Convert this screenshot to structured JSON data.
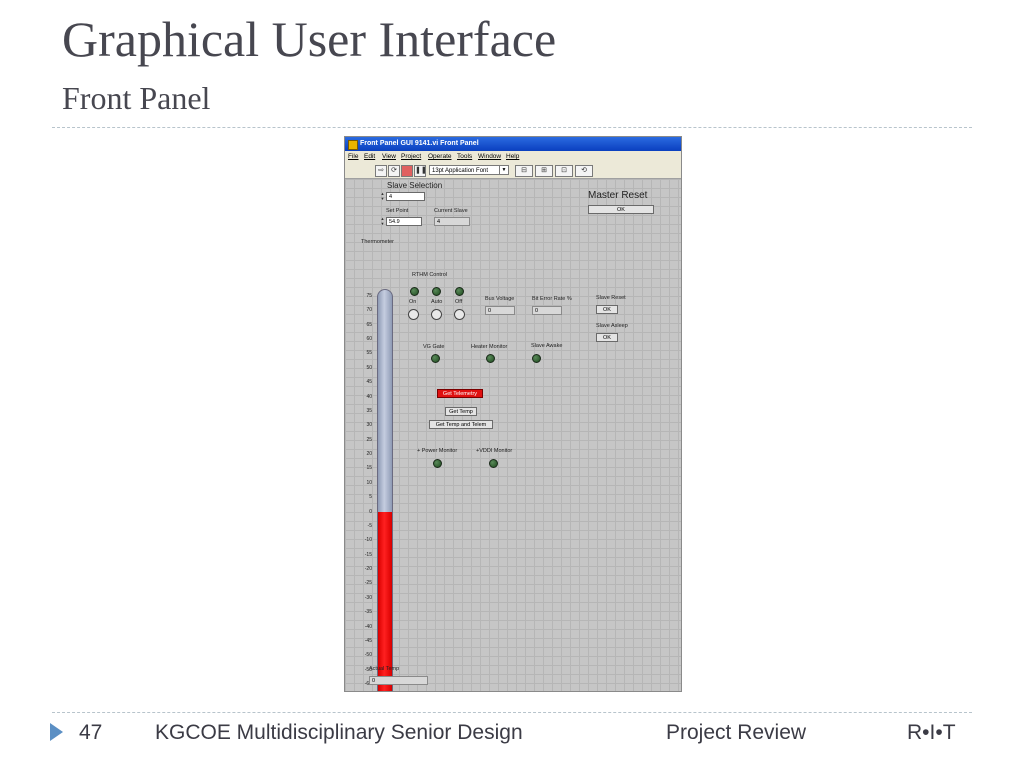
{
  "slide": {
    "title": "Graphical User Interface",
    "subtitle": "Front Panel"
  },
  "footer": {
    "page_number": "47",
    "course": "KGCOE Multidisciplinary Senior Design",
    "event": "Project Review",
    "logo": "R•I•T"
  },
  "window": {
    "title": "Front Panel GUI 9141.vi Front Panel",
    "menu": [
      "File",
      "Edit",
      "View",
      "Project",
      "Operate",
      "Tools",
      "Window",
      "Help"
    ],
    "font_select": "13pt Application Font"
  },
  "panel": {
    "slave_selection_label": "Slave Selection",
    "slave_selection_value": "4",
    "set_point_label": "Set Point",
    "set_point_value": "54.9",
    "current_slave_label": "Current Slave",
    "current_slave_value": "4",
    "master_reset_label": "Master Reset",
    "master_reset_button": "OK",
    "thermometer_label": "Thermometer",
    "rthm_control_label": "RTHM Control",
    "rthm_on": "On",
    "rthm_auto": "Auto",
    "rthm_off": "Off",
    "bus_voltage_label": "Bus Voltage",
    "bus_voltage_value": "0",
    "bit_error_label": "Bit Error Rate %",
    "bit_error_value": "0",
    "slave_reset_label": "Slave Reset",
    "slave_reset_button": "OK",
    "slave_asleep_label": "Slave Asleep",
    "slave_asleep_button": "OK",
    "vg_gate_label": "VG Gate",
    "heater_monitor_label": "Heater Monitor",
    "slave_awake_label": "Slave Awake",
    "get_telemetry_button": "Get Telemetry",
    "get_temp_button": "Get Temp",
    "get_temp_telem_button": "Get Temp and Telem",
    "power_monitor_label": "+ Power Monitor",
    "vddi_monitor_label": "+VDDI Monitor",
    "actual_temp_label": "Actual Temp",
    "actual_temp_value": "0",
    "thermometer_scale": [
      "75",
      "70",
      "65",
      "60",
      "55",
      "50",
      "45",
      "40",
      "35",
      "30",
      "25",
      "20",
      "15",
      "10",
      "5",
      "0",
      "-5",
      "-10",
      "-15",
      "-20",
      "-25",
      "-30",
      "-35",
      "-40",
      "-45",
      "-50",
      "-55",
      "-60"
    ],
    "thermometer_value": 0,
    "thermometer_min": -65,
    "thermometer_max": 80,
    "colors": {
      "fill": "#e01010",
      "tube": "#aab4cc",
      "telemetry_button": "#e01010",
      "led": "#2e5e2e"
    }
  }
}
